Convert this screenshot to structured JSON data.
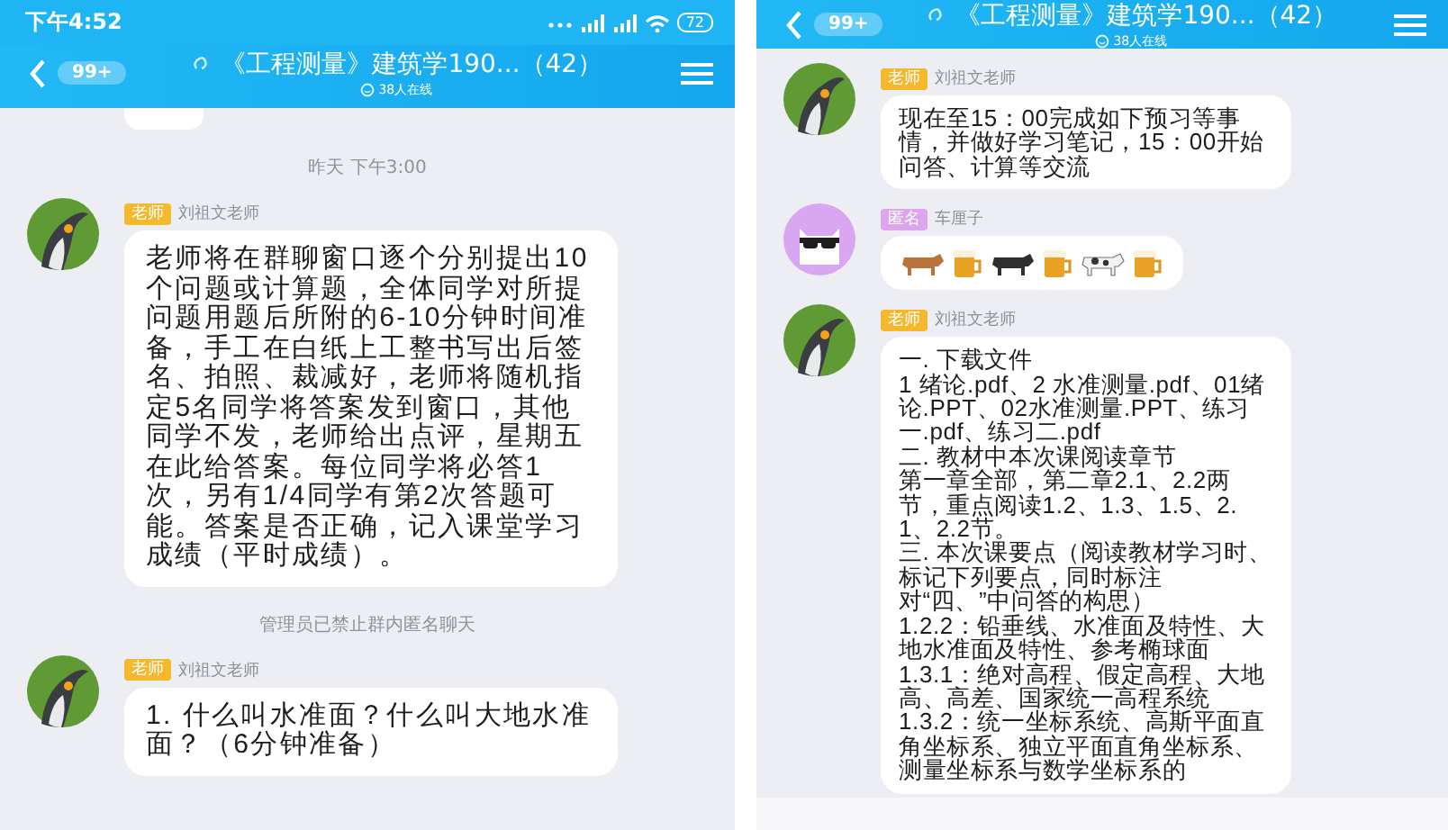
{
  "screens": [
    {
      "status_bar": {
        "time": "下午4:52",
        "battery": "72"
      },
      "header": {
        "unread": "99+",
        "title": "《工程测量》建筑学190...（42）",
        "online": "38人在线"
      },
      "messages": [
        {
          "kind": "partial"
        },
        {
          "kind": "time",
          "text": "昨天 下午3:00"
        },
        {
          "kind": "message",
          "avatar": {
            "kind": "penguin"
          },
          "badge": {
            "label": "老师",
            "color": "#f5b82c"
          },
          "sender": "刘祖文老师",
          "text": "老师将在群聊窗口逐个分别提出10个问题或计算题，全体同学对所提问题用题后所附的6-10分钟时间准备，手工在白纸上工整书写出后签名、拍照、裁减好，老师将随机指定5名同学将答案发到窗口，其他同学不发，老师给出点评，星期五在此给答案。每位同学将必答1次，另有1/4同学有第2次答题可能。答案是否正确，记入课堂学习成绩（平时成绩）。"
        },
        {
          "kind": "notice",
          "text": "管理员已禁止群内匿名聊天"
        },
        {
          "kind": "message",
          "avatar": {
            "kind": "penguin"
          },
          "badge": {
            "label": "老师",
            "color": "#f5b82c"
          },
          "sender": "刘祖文老师",
          "text": "1. 什么叫水准面？什么叫大地水准面？（6分钟准备）"
        }
      ]
    },
    {
      "header": {
        "unread": "99+",
        "title": "《工程测量》建筑学190...（42）",
        "online": "38人在线"
      },
      "messages": [
        {
          "kind": "message",
          "avatar": {
            "kind": "penguin"
          },
          "badge": {
            "label": "老师",
            "color": "#f5b82c"
          },
          "sender": "刘祖文老师",
          "text": "现在至15：00完成如下预习等事情，并做好学习笔记，15：00开始问答、计算等交流"
        },
        {
          "kind": "message",
          "avatar": {
            "kind": "cat"
          },
          "badge": {
            "label": "匿名",
            "color": "#dca6ef"
          },
          "sender": "车厘子",
          "emojis": [
            {
              "kind": "cow"
            },
            {
              "kind": "beer"
            },
            {
              "kind": "ox"
            },
            {
              "kind": "beer"
            },
            {
              "kind": "dairy-cow"
            },
            {
              "kind": "beer"
            }
          ]
        },
        {
          "kind": "message",
          "avatar": {
            "kind": "penguin"
          },
          "badge": {
            "label": "老师",
            "color": "#f5b82c"
          },
          "sender": "刘祖文老师",
          "paragraphs": [
            "一. 下载文件",
            "1 绪论.pdf、2 水准测量.pdf、01绪论.PPT、02水准测量.PPT、练习一.pdf、练习二.pdf",
            "二. 教材中本次课阅读章节",
            "第一章全部，第二章2.1、2.2两节，重点阅读1.2、1.3、1.5、2.1、2.2节。",
            "三. 本次课要点（阅读教材学习时、标记下列要点，同时标注对“四、”中问答的构思）",
            "1.2.2：铅垂线、水准面及特性、大地水准面及特性、参考椭球面",
            "1.3.1：绝对高程、假定高程、大地高、高差、国家统一高程系统",
            "1.3.2：统一坐标系统、高斯平面直角坐标系、独立平面直角坐标系、测量坐标系与数学坐标系的"
          ]
        }
      ]
    }
  ]
}
